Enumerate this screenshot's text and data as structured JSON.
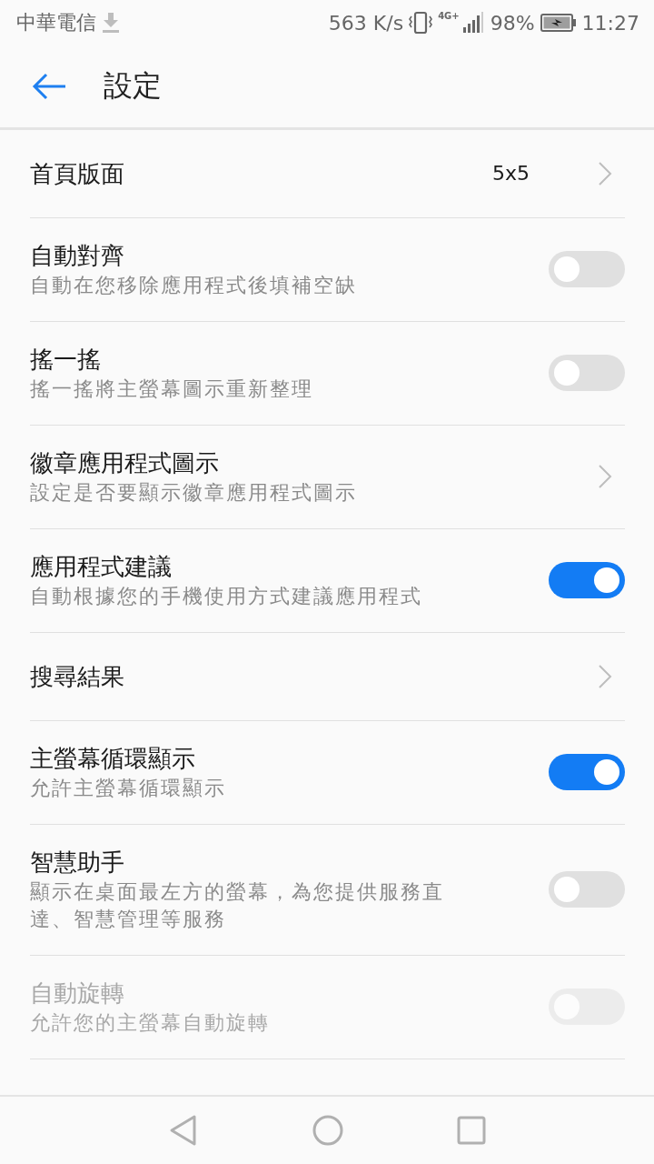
{
  "status_bar": {
    "carrier": "中華電信",
    "speed": "563 K/s",
    "network_type": "4G+",
    "battery": "98%",
    "time": "11:27"
  },
  "app_bar": {
    "title": "設定"
  },
  "items": [
    {
      "kind": "value",
      "title": "首頁版面",
      "value": "5x5",
      "disabled": false
    },
    {
      "kind": "toggle",
      "title": "自動對齊",
      "subtitle": "自動在您移除應用程式後填補空缺",
      "on": false,
      "disabled": false
    },
    {
      "kind": "toggle",
      "title": "搖一搖",
      "subtitle": "搖一搖將主螢幕圖示重新整理",
      "on": false,
      "disabled": false
    },
    {
      "kind": "link",
      "title": "徽章應用程式圖示",
      "subtitle": "設定是否要顯示徽章應用程式圖示",
      "disabled": false
    },
    {
      "kind": "toggle",
      "title": "應用程式建議",
      "subtitle": "自動根據您的手機使用方式建議應用程式",
      "on": true,
      "disabled": false
    },
    {
      "kind": "link",
      "title": "搜尋結果",
      "disabled": false
    },
    {
      "kind": "toggle",
      "title": "主螢幕循環顯示",
      "subtitle": "允許主螢幕循環顯示",
      "on": true,
      "disabled": false
    },
    {
      "kind": "toggle",
      "title": "智慧助手",
      "subtitle": "顯示在桌面最左方的螢幕，為您提供服務直達、智慧管理等服務",
      "on": false,
      "disabled": false
    },
    {
      "kind": "toggle",
      "title": "自動旋轉",
      "subtitle": "允許您的主螢幕自動旋轉",
      "on": false,
      "disabled": true
    }
  ]
}
